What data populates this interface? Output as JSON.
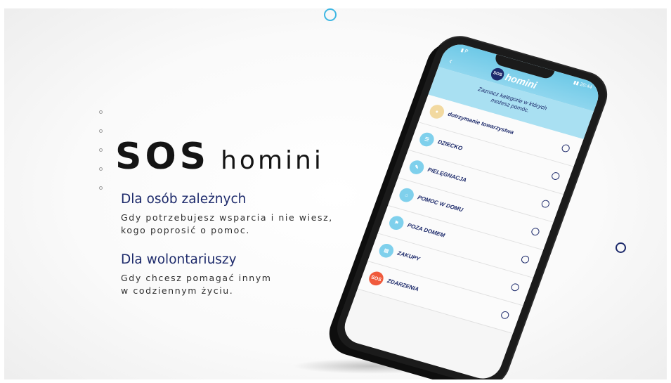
{
  "brand": {
    "sos": "SOS",
    "homini": "homini"
  },
  "sections": [
    {
      "heading": "Dla osób zależnych",
      "lines": [
        "Gdy potrzebujesz wsparcia i nie wiesz,",
        "kogo poprosić o pomoc."
      ]
    },
    {
      "heading": "Dla wolontariuszy",
      "lines": [
        "Gdy chcesz pomagać innym",
        "w codziennym życiu."
      ]
    }
  ],
  "phone": {
    "status_left": "▮ P",
    "status_right": "▮▮ 20:44",
    "app_badge": "SOS",
    "app_name": "homini",
    "back_icon": "back-arrow-icon",
    "prompt_lines": [
      "Zaznacz kategorie w których",
      "możesz pomóc."
    ],
    "categories": [
      {
        "label": "dotrzymanie towarzystwa",
        "icon": "company-icon",
        "color": "#f2d9a0",
        "selected": false
      },
      {
        "label": "DZIECKO",
        "icon": "child-icon",
        "color": "#7fd0ec",
        "selected": false
      },
      {
        "label": "PIELĘGNACJA",
        "icon": "care-icon",
        "color": "#7fd0ec",
        "selected": false
      },
      {
        "label": "POMOC W DOMU",
        "icon": "home-help-icon",
        "color": "#7fd0ec",
        "selected": false
      },
      {
        "label": "POZA DOMEM",
        "icon": "outside-icon",
        "color": "#7fd0ec",
        "selected": false
      },
      {
        "label": "ZAKUPY",
        "icon": "shopping-icon",
        "color": "#7fd0ec",
        "selected": false
      },
      {
        "label": "ZDARZENIA",
        "icon": "sos-events-icon",
        "color": "#f05a3c",
        "selected": false
      }
    ]
  },
  "colors": {
    "accent_blue": "#1d2a6b",
    "app_cyan": "#6ec9e7",
    "ring_cyan": "#3fb7e3"
  }
}
